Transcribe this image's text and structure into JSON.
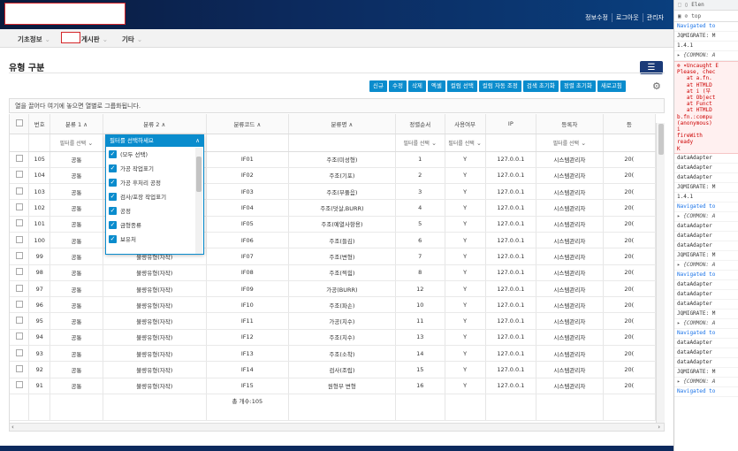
{
  "header": {
    "links": [
      "정보수정",
      "로그아웃",
      "관리자"
    ]
  },
  "menu": [
    {
      "label": "기초정보"
    },
    {
      "label": "게시판"
    },
    {
      "label": "기타"
    }
  ],
  "page": {
    "title": "유형 구분"
  },
  "toolbar": [
    "신규",
    "수정",
    "삭제",
    "엑셀",
    "컬럼 선택",
    "컬럼 자동 조정",
    "검색 초기화",
    "정렬 초기화",
    "새로고침"
  ],
  "grouping_tip": "열을 끌어다 여기에 놓으면 열별로 그룹화됩니다.",
  "columns": [
    "번호",
    "분류 1",
    "분류 2",
    "분류코드",
    "분류명",
    "정렬순서",
    "사용여부",
    "IP",
    "등록자",
    "등"
  ],
  "filters": {
    "placeholder": "필터를 선택",
    "open": "필터를 선택하세요"
  },
  "rows": [
    {
      "no": "105",
      "c1": "공통",
      "c2": "",
      "code": "IF01",
      "name": "주조(미성형)",
      "order": "1",
      "use": "Y",
      "ip": "127.0.0.1",
      "user": "시스템관리자",
      "reg": "20("
    },
    {
      "no": "104",
      "c1": "공통",
      "c2": "",
      "code": "IF02",
      "name": "주조(기포)",
      "order": "2",
      "use": "Y",
      "ip": "127.0.0.1",
      "user": "시스템관리자",
      "reg": "20("
    },
    {
      "no": "103",
      "c1": "공통",
      "c2": "",
      "code": "IF03",
      "name": "주조(부풀음)",
      "order": "3",
      "use": "Y",
      "ip": "127.0.0.1",
      "user": "시스템관리자",
      "reg": "20("
    },
    {
      "no": "102",
      "c1": "공통",
      "c2": "",
      "code": "IF04",
      "name": "주조(덧살,BURR)",
      "order": "4",
      "use": "Y",
      "ip": "127.0.0.1",
      "user": "시스템관리자",
      "reg": "20("
    },
    {
      "no": "101",
      "c1": "공통",
      "c2": "",
      "code": "IF05",
      "name": "주조(예열사항용)",
      "order": "5",
      "use": "Y",
      "ip": "127.0.0.1",
      "user": "시스템관리자",
      "reg": "20("
    },
    {
      "no": "100",
      "c1": "공통",
      "c2": "",
      "code": "IF06",
      "name": "주조(들김)",
      "order": "6",
      "use": "Y",
      "ip": "127.0.0.1",
      "user": "시스템관리자",
      "reg": "20("
    },
    {
      "no": "99",
      "c1": "공통",
      "c2": "불량유형(자작)",
      "code": "IF07",
      "name": "주조(변형)",
      "order": "7",
      "use": "Y",
      "ip": "127.0.0.1",
      "user": "시스템관리자",
      "reg": "20("
    },
    {
      "no": "98",
      "c1": "공통",
      "c2": "불량유형(자작)",
      "code": "IF08",
      "name": "주조(찍힘)",
      "order": "8",
      "use": "Y",
      "ip": "127.0.0.1",
      "user": "시스템관리자",
      "reg": "20("
    },
    {
      "no": "97",
      "c1": "공통",
      "c2": "불량유형(자작)",
      "code": "IF09",
      "name": "가공(BURR)",
      "order": "12",
      "use": "Y",
      "ip": "127.0.0.1",
      "user": "시스템관리자",
      "reg": "20("
    },
    {
      "no": "96",
      "c1": "공통",
      "c2": "불량유형(자작)",
      "code": "IF10",
      "name": "주조(파손)",
      "order": "10",
      "use": "Y",
      "ip": "127.0.0.1",
      "user": "시스템관리자",
      "reg": "20("
    },
    {
      "no": "95",
      "c1": "공통",
      "c2": "불량유형(자작)",
      "code": "IF11",
      "name": "가공(치수)",
      "order": "11",
      "use": "Y",
      "ip": "127.0.0.1",
      "user": "시스템관리자",
      "reg": "20("
    },
    {
      "no": "94",
      "c1": "공통",
      "c2": "불량유형(자작)",
      "code": "IF12",
      "name": "주조(치수)",
      "order": "13",
      "use": "Y",
      "ip": "127.0.0.1",
      "user": "시스템관리자",
      "reg": "20("
    },
    {
      "no": "93",
      "c1": "공통",
      "c2": "불량유형(자작)",
      "code": "IF13",
      "name": "주조(소착)",
      "order": "14",
      "use": "Y",
      "ip": "127.0.0.1",
      "user": "시스템관리자",
      "reg": "20("
    },
    {
      "no": "92",
      "c1": "공통",
      "c2": "불량유형(자작)",
      "code": "IF14",
      "name": "검사(조립)",
      "order": "15",
      "use": "Y",
      "ip": "127.0.0.1",
      "user": "시스템관리자",
      "reg": "20("
    },
    {
      "no": "91",
      "c1": "공통",
      "c2": "불량유형(자작)",
      "code": "IF15",
      "name": "원형부 변형",
      "order": "16",
      "use": "Y",
      "ip": "127.0.0.1",
      "user": "시스템관리자",
      "reg": "20("
    }
  ],
  "total": "총 개수:105",
  "dropdown_items": [
    "(모두 선택)",
    "가공 작업표기",
    "가공 후처리 공정",
    "검사/포장 작업표기",
    "공정",
    "금형종류",
    "보유처"
  ],
  "devtools": {
    "tabs": [
      "Elen"
    ],
    "filter": "top",
    "lines": [
      {
        "t": "nav",
        "s": "Navigated to"
      },
      {
        "t": "log",
        "s": "JQMIGRATE: M"
      },
      {
        "t": "log",
        "s": "1.4.1"
      },
      {
        "t": "obj",
        "s": "▸ {COMMON: A"
      },
      {
        "t": "err",
        "s": "⊗ ▾Uncaught E\nPlease, chec\n   at a.fn.\n   at HTMLD\n   at i (부\n   at Object\n   at Funct\n   at HTMLD\nb.fn.:compu\n(anonymous)\ni\nfireWith\nready\nK"
      },
      {
        "t": "log",
        "s": "dataAdapter"
      },
      {
        "t": "log",
        "s": "dataAdapter"
      },
      {
        "t": "log",
        "s": "dataAdapter"
      },
      {
        "t": "log",
        "s": "JQMIGRATE: M"
      },
      {
        "t": "log",
        "s": "1.4.1"
      },
      {
        "t": "nav",
        "s": "Navigated to"
      },
      {
        "t": "obj",
        "s": "▸ {COMMON: A"
      },
      {
        "t": "log",
        "s": "dataAdapter"
      },
      {
        "t": "log",
        "s": "dataAdapter"
      },
      {
        "t": "log",
        "s": "dataAdapter"
      },
      {
        "t": "log",
        "s": "JQMIGRATE: M"
      },
      {
        "t": "obj",
        "s": "▸ {COMMON: A"
      },
      {
        "t": "nav",
        "s": "Navigated to"
      },
      {
        "t": "log",
        "s": "dataAdapter"
      },
      {
        "t": "log",
        "s": "dataAdapter"
      },
      {
        "t": "log",
        "s": "dataAdapter"
      },
      {
        "t": "log",
        "s": "JQMIGRATE: M"
      },
      {
        "t": "obj",
        "s": "▸ {COMMON: A"
      },
      {
        "t": "nav",
        "s": "Navigated to"
      },
      {
        "t": "log",
        "s": "dataAdapter"
      },
      {
        "t": "log",
        "s": "dataAdapter"
      },
      {
        "t": "log",
        "s": "dataAdapter"
      },
      {
        "t": "log",
        "s": "JQMIGRATE: M"
      },
      {
        "t": "obj",
        "s": "▸ {COMMON: A"
      },
      {
        "t": "nav",
        "s": "Navigated to"
      }
    ]
  }
}
